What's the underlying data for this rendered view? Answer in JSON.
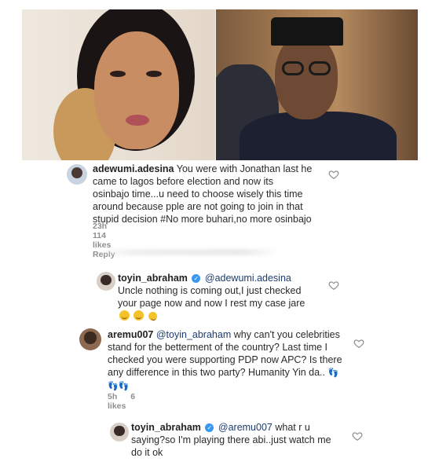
{
  "post_image": {
    "left_subject": "woman-portrait",
    "right_subject": "man-portrait"
  },
  "comments": [
    {
      "username": "adewumi.adesina",
      "text": "You were with Jonathan last he came to lagos before election and now its osinbajo time...u need to choose wisely this time around because pple are not going to join in that stupid decision #No more buhari,no more osinbajo",
      "time": "23h",
      "likes": "114 likes",
      "reply": "Reply"
    },
    {
      "username": "toyin_abraham",
      "mention": "@adewumi.adesina",
      "text": "Uncle nothing is coming out,I just checked your page now and now I rest my case jare"
    },
    {
      "username": "aremu007",
      "mention": "@toyin_abraham",
      "text": "why can't you celebrities stand for the betterment of the country? Last time I checked you were supporting PDP now APC? Is there any difference in this two party? Humanity Yin da..",
      "time": "5h",
      "likes": "6 likes"
    },
    {
      "username": "toyin_abraham",
      "mention": "@aremu007",
      "text": "what r u saying?so I'm playing there abi..just watch me do it ok"
    }
  ],
  "colors": {
    "username": "#222222",
    "mention": "#1d3c6e",
    "meta": "#8e8e8e",
    "verified": "#3897f0"
  },
  "icons": [
    "heart-icon",
    "verified-badge-icon",
    "emoji-icon",
    "footprints-emoji-icon"
  ]
}
